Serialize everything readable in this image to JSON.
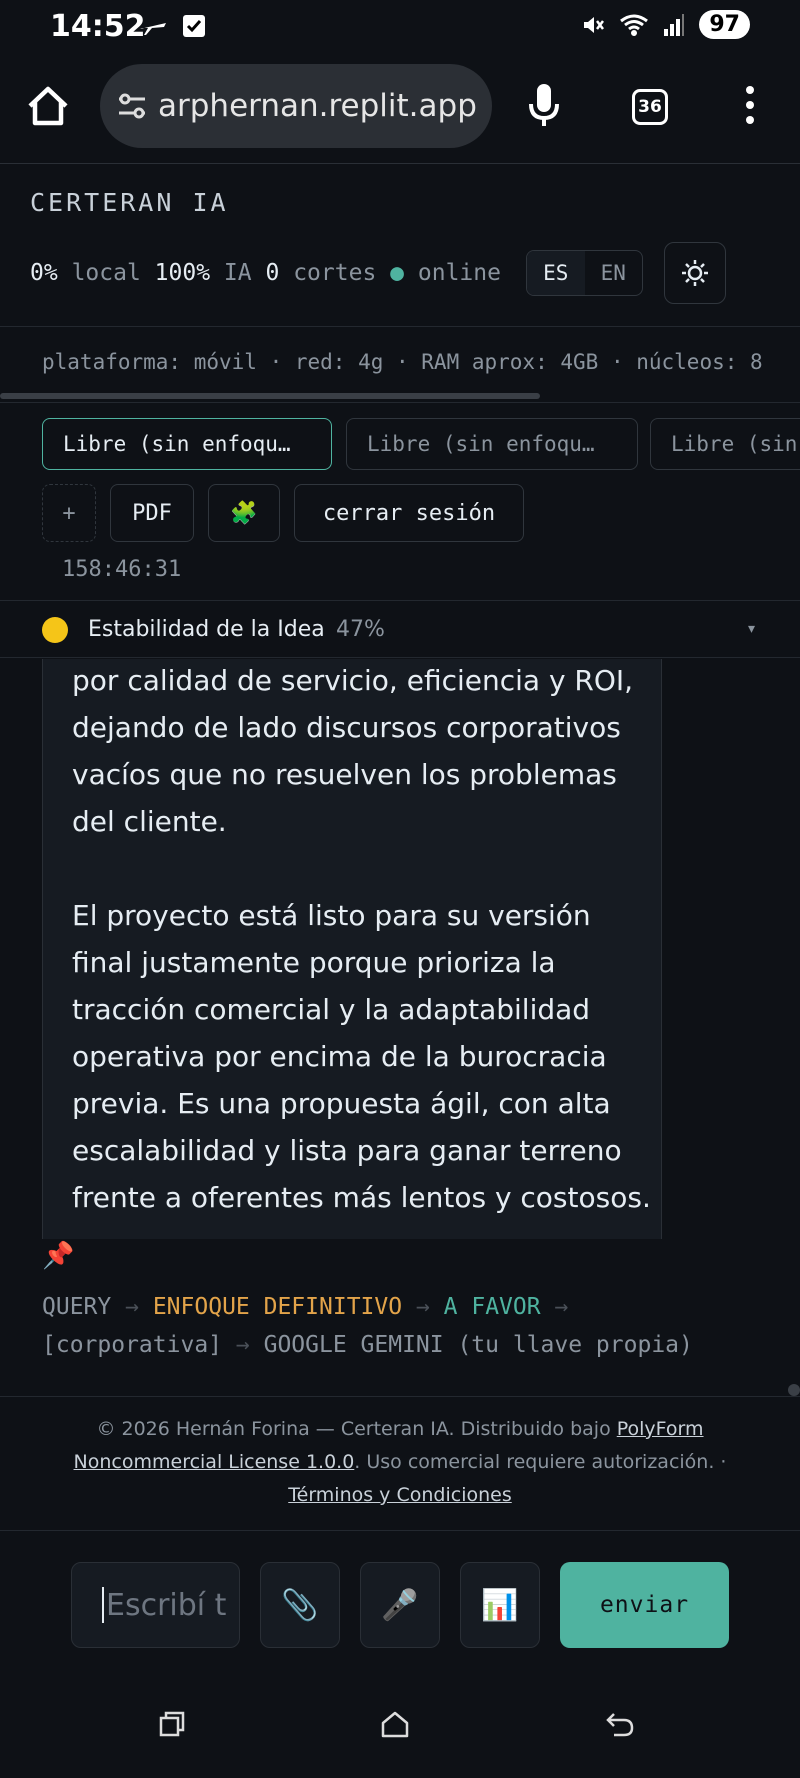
{
  "status_bar": {
    "time": "14:52",
    "battery": "97"
  },
  "browser": {
    "url": "arphernan.replit.app",
    "tab_count": "36"
  },
  "app": {
    "title": "CERTERAN IA",
    "stats": {
      "local_pct": "0%",
      "local_label": "local",
      "ia_pct": "100%",
      "ia_label": "IA",
      "cortes_num": "0",
      "cortes_label": "cortes",
      "online_dot": "●",
      "online_label": "online"
    },
    "lang": {
      "es": "ES",
      "en": "EN"
    },
    "platform_info": "plataforma: móvil · red: 4g · RAM aprox: 4GB · núcleos: 8"
  },
  "chips": [
    "Libre (sin enfoqu…",
    "Libre (sin enfoqu…",
    "Libre (sin"
  ],
  "actions": {
    "add": "+",
    "pdf": "PDF",
    "plugin": "🧩",
    "logout": "cerrar sesión"
  },
  "timer": "158:46:31",
  "stability": {
    "label": "Estabilidad de la Idea",
    "percent": "47%",
    "caret": "▾"
  },
  "message": {
    "paragraph1": "por calidad de servicio, eficiencia y ROI, dejando de lado discursos corporativos vacíos que no resuelven los problemas del cliente.",
    "paragraph2": "El proyecto está listo para su versión final justamente porque prioriza la tracción comercial y la adaptabilidad operativa por encima de la burocracia previa. Es una propuesta ágil, con alta escalabilidad y lista para ganar terreno frente a oferentes más lentos y costosos."
  },
  "pin": "📌",
  "trace": {
    "query": "QUERY",
    "arrow": "→",
    "enfoque": "ENFOQUE DEFINITIVO",
    "favor": "A FAVOR",
    "corporativa": "[corporativa]",
    "model": "GOOGLE GEMINI (tu llave propia)"
  },
  "footer": {
    "prefix": "© 2026 Hernán Forina — Certeran IA. Distribuido bajo ",
    "license_link": "PolyForm Noncommercial License 1.0.0",
    "suffix": ". Uso comercial requiere autorización. ·",
    "terms_link": "Términos y Condiciones"
  },
  "composer": {
    "placeholder": "Escribí t",
    "attach": "📎",
    "mic": "🎤",
    "chart": "📊",
    "send": "enviar"
  },
  "colors": {
    "accent": "#4fb3a0",
    "warning": "#e3a44a",
    "background": "#0e1116",
    "surface": "#161b22"
  }
}
